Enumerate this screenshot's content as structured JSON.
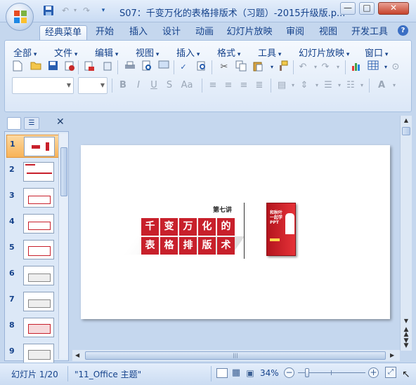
{
  "window": {
    "title": "S07：千变万化的表格排版术（习题）-2015升级版.p...",
    "buttons": {
      "minimize": "—",
      "maximize": "□",
      "close": "✕"
    }
  },
  "qat": {
    "save_icon": "save-icon",
    "undo": "↶",
    "redo": "↷",
    "more": "▾"
  },
  "tabs": [
    {
      "label": "经典菜单",
      "active": true
    },
    {
      "label": "开始"
    },
    {
      "label": "插入"
    },
    {
      "label": "设计"
    },
    {
      "label": "动画"
    },
    {
      "label": "幻灯片放映"
    },
    {
      "label": "审阅"
    },
    {
      "label": "视图"
    },
    {
      "label": "开发工具"
    }
  ],
  "help_label": "?",
  "menus": [
    "全部",
    "文件",
    "编辑",
    "视图",
    "插入",
    "格式",
    "工具",
    "幻灯片放映",
    "窗口"
  ],
  "format": {
    "bold": "B",
    "italic": "I",
    "underline": "U",
    "strike": "S",
    "shadow": "Aa",
    "font_color": "A"
  },
  "slide": {
    "lecture": "第七讲",
    "title_chars": [
      "千",
      "变",
      "万",
      "化",
      "的",
      "表",
      "格",
      "排",
      "版",
      "术"
    ],
    "accent": "#c8202b",
    "book_title": "和秋叶一起学PPT",
    "book_color": "#d9232e"
  },
  "thumbnails": [
    {
      "num": "1",
      "selected": true
    },
    {
      "num": "2"
    },
    {
      "num": "3"
    },
    {
      "num": "4"
    },
    {
      "num": "5"
    },
    {
      "num": "6"
    },
    {
      "num": "7"
    },
    {
      "num": "8"
    },
    {
      "num": "9"
    }
  ],
  "status": {
    "slide_info": "幻灯片 1/20",
    "theme": "\"11_Office 主题\"",
    "zoom": "34%",
    "zoom_level": 0.34
  }
}
